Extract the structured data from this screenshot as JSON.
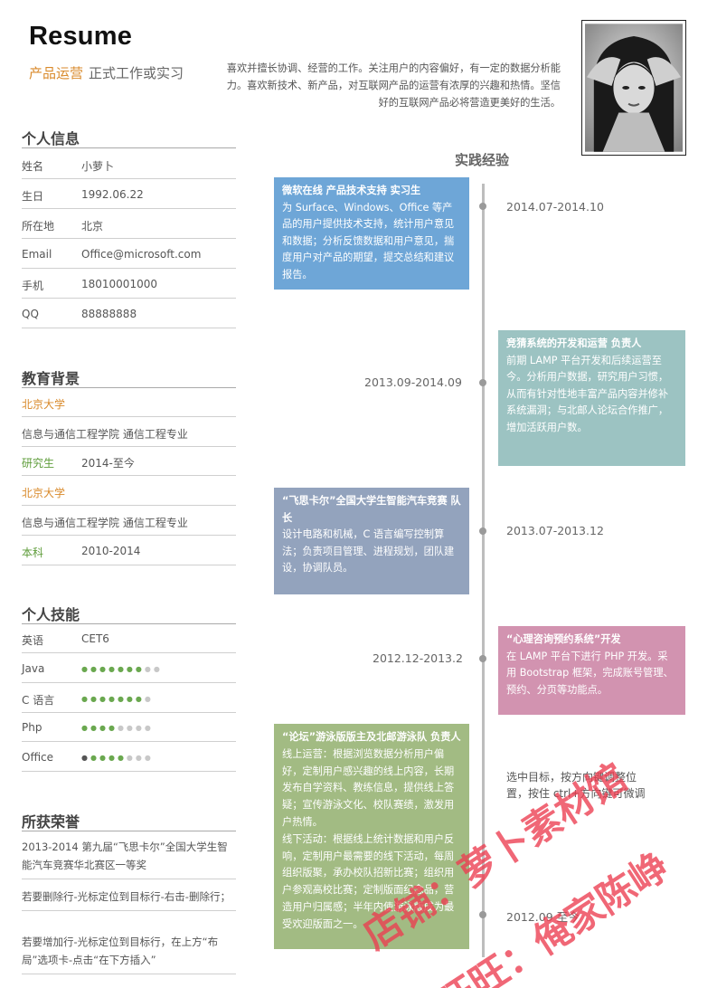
{
  "header": {
    "title": "Resume",
    "role_highlight": "产品运营",
    "role_rest": "正式工作或实习",
    "intro": "喜欢并擅长协调、经营的工作。关注用户的内容偏好，有一定的数据分析能力。喜欢新技术、新产品，对互联网产品的运营有浓厚的兴趣和热情。坚信好的互联网产品必将营造更美好的生活。"
  },
  "personal": {
    "title": "个人信息",
    "rows": [
      {
        "k": "姓名",
        "v": "小萝卜"
      },
      {
        "k": "生日",
        "v": "1992.06.22"
      },
      {
        "k": "所在地",
        "v": "北京"
      },
      {
        "k": " Email",
        "v": "Office@microsoft.com"
      },
      {
        "k": "手机",
        "v": "18010001000"
      },
      {
        "k": "QQ",
        "v": "88888888"
      }
    ]
  },
  "education": {
    "title": "教育背景",
    "rows": [
      {
        "text": "北京大学"
      },
      {
        "text": "信息与通信工程学院 通信工程专业"
      },
      {
        "k": "研究生",
        "v": "2014-至今"
      },
      {
        "text": "北京大学"
      },
      {
        "text": "信息与通信工程学院 通信工程专业"
      },
      {
        "k": "本科",
        "v": "2010-2014"
      }
    ]
  },
  "skills": {
    "title": "个人技能",
    "english": {
      "k": "英语",
      "v": "CET6"
    },
    "items": [
      {
        "k": "Java",
        "level": 7,
        "max": 9
      },
      {
        "k": "C 语言",
        "level": 7,
        "max": 8
      },
      {
        "k": "Php",
        "level": 4,
        "max": 8
      },
      {
        "k": "Office",
        "level": 5,
        "max": 8
      }
    ]
  },
  "honors": {
    "title": "所获荣誉",
    "items": [
      "2013-2014 第九届“飞思卡尔”全国大学生智能汽车竞赛华北赛区一等奖",
      "若要删除行-光标定位到目标行-右击-删除行；",
      "若要增加行-光标定位到目标行，在上方“布局”选项卡-点击“在下方插入”"
    ]
  },
  "timeline": {
    "title": "实践经验",
    "entries": [
      {
        "date": "2014.07-2014.10",
        "title": "微软在线  产品技术支持  实习生",
        "body": "为 Surface、Windows、Office 等产品的用户提供技术支持，统计用户意见和数据；分析反馈数据和用户意见，揣度用户对产品的期望，提交总结和建议报告。"
      },
      {
        "date": "2013.09-2014.09",
        "title": "竞猜系统的开发和运营  负责人",
        "body": "前期 LAMP 平台开发和后续运营至今。分析用户数据，研究用户习惯，从而有针对性地丰富产品内容并修补系统漏洞；与北邮人论坛合作推广，增加活跃用户数。"
      },
      {
        "date": "2013.07-2013.12",
        "title": "“飞思卡尔”全国大学生智能汽车竞赛  队长",
        "body": "设计电路和机械，C 语言编写控制算法；负责项目管理、进程规划，团队建设，协调队员。"
      },
      {
        "date": "2012.12-2013.2",
        "title": "“心理咨询预约系统”开发",
        "body": "在 LAMP 平台下进行 PHP 开发。采用 Bootstrap 框架，完成账号管理、预约、分页等功能点。"
      },
      {
        "date": "2012.09  至今",
        "title": "“论坛”游泳版版主及北邮游泳队  负责人",
        "body": "线上运营：根据浏览数据分析用户偏好，定制用户感兴趣的线上内容，长期发布自学资料、教练信息，提供线上答疑；宣传游泳文化、校队赛绩，激发用户热情。",
        "body2": "线下活动：根据线上统计数据和用户反响，定制用户最需要的线下活动，每周组织版聚，承办校队招新比赛；组织用户参观高校比赛；定制版面纪念品，营造用户归属感；半年内使游泳版成为最受欢迎版面之一。"
      }
    ],
    "note": "选中目标，按方向键调整位置，按住 ctrl+方向键可微调"
  },
  "watermark": {
    "line1": "店铺：萝卜素材馆",
    "line2": "旺旺：俺家陈峥"
  },
  "colors": {
    "accent_orange": "#d98a2b",
    "accent_green": "#5e9c3a",
    "card_blue": "#6ea6d7",
    "card_teal": "#9cc3c2",
    "card_slate": "#93a3bd",
    "card_pink": "#d293b0",
    "card_green": "#a2bb83"
  }
}
